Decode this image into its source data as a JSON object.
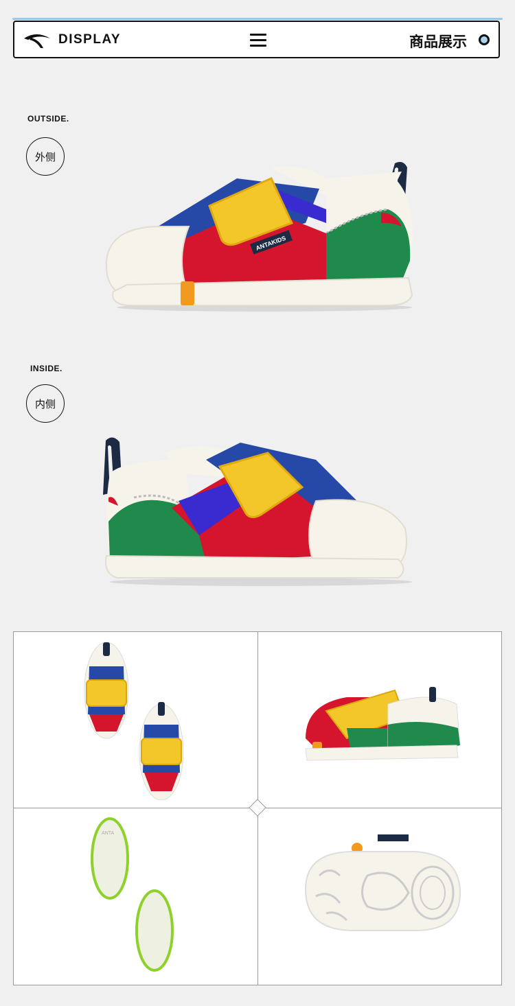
{
  "header": {
    "brand": "DISPLAY",
    "title_cn": "商品展示",
    "logo_icon": "anta-logo-icon",
    "menu_icon": "hamburger-menu-icon",
    "indicator_color": "#a9d3ee"
  },
  "outside": {
    "label_en": "OUTSIDE.",
    "label_cn": "外侧"
  },
  "inside": {
    "label_en": "INSIDE.",
    "label_cn": "内侧"
  },
  "shoe_text": "ANTAKIDS",
  "insole_text": "ANTA",
  "colors": {
    "red": "#d4152d",
    "blue": "#2649a8",
    "yellow": "#f3c72a",
    "green": "#1f8a4c",
    "white": "#f6f3ea",
    "navy": "#1d2a44",
    "orange": "#f29a1f",
    "lime": "#8fd12c"
  }
}
